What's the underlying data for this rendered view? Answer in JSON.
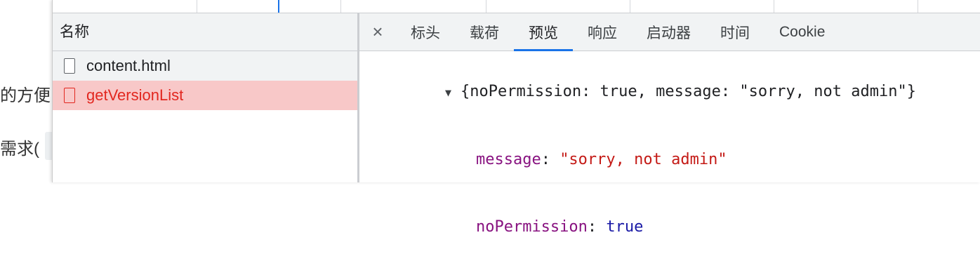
{
  "background_page": {
    "line1": "的方便",
    "line2": "需求("
  },
  "names_panel": {
    "header": "名称",
    "requests": [
      {
        "name": "content.html",
        "selected": false
      },
      {
        "name": "getVersionList",
        "selected": true
      }
    ]
  },
  "detail_panel": {
    "close_symbol": "×",
    "tabs": [
      "标头",
      "载荷",
      "预览",
      "响应",
      "启动器",
      "时间",
      "Cookie"
    ],
    "active_tab": "预览",
    "preview": {
      "summary": "{noPermission: true, message: \"sorry, not admin\"}",
      "fields": [
        {
          "key": "message",
          "value": "\"sorry, not admin\"",
          "type": "string"
        },
        {
          "key": "noPermission",
          "value": "true",
          "type": "boolean"
        }
      ]
    }
  },
  "colors": {
    "accent": "#1a73e8",
    "selected_row_bg": "#f8c8c8",
    "selected_row_text": "#e2271f",
    "json_key": "#881280",
    "json_string": "#c41a16",
    "json_boolean": "#1a1aa6"
  }
}
